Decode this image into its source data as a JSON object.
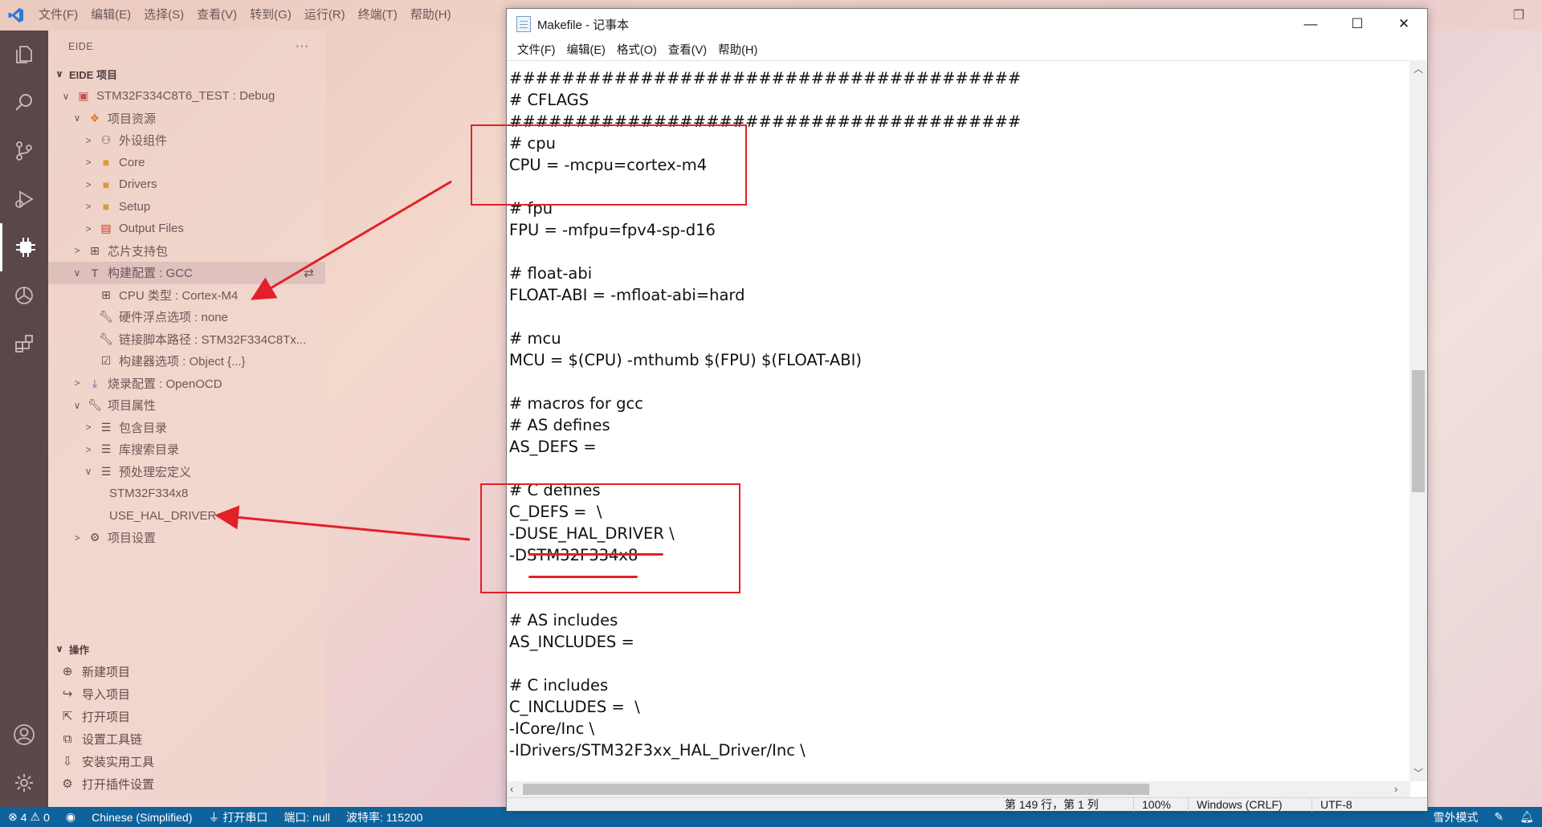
{
  "vscode": {
    "menu": [
      "文件(F)",
      "编辑(E)",
      "选择(S)",
      "查看(V)",
      "转到(G)",
      "运行(R)",
      "终端(T)",
      "帮助(H)"
    ],
    "sidebar": {
      "title": "EIDE",
      "more": "···",
      "section": "EIDE 项目",
      "tree": [
        {
          "label": "STM32F334C8T6_TEST : Debug",
          "indent": 1,
          "chev": "∨",
          "icon": "project-icon",
          "color": "#c0504d"
        },
        {
          "label": "项目资源",
          "indent": 2,
          "chev": "∨",
          "icon": "resources-icon",
          "color": "#e07b2a"
        },
        {
          "label": "外设组件",
          "indent": 3,
          "chev": ">",
          "icon": "components-icon",
          "color": "#6b5858"
        },
        {
          "label": "Core",
          "indent": 3,
          "chev": ">",
          "icon": "folder-icon",
          "color": "#d99a3a"
        },
        {
          "label": "Drivers",
          "indent": 3,
          "chev": ">",
          "icon": "folder-icon",
          "color": "#d99a3a"
        },
        {
          "label": "Setup",
          "indent": 3,
          "chev": ">",
          "icon": "folder-icon",
          "color": "#d99a3a"
        },
        {
          "label": "Output Files",
          "indent": 3,
          "chev": ">",
          "icon": "output-icon",
          "color": "#c0392b"
        },
        {
          "label": "芯片支持包",
          "indent": 2,
          "chev": ">",
          "icon": "chip-icon",
          "color": "#5e4a4a"
        },
        {
          "label": "构建配置 : GCC",
          "indent": 2,
          "chev": "∨",
          "icon": "build-icon",
          "color": "#5e4a4a",
          "selected": true
        },
        {
          "label": "CPU 类型 : Cortex-M4",
          "indent": 3,
          "chev": "",
          "icon": "chip-icon",
          "color": "#5e4a4a"
        },
        {
          "label": "硬件浮点选项 : none",
          "indent": 3,
          "chev": "",
          "icon": "wrench-icon",
          "color": "#5e4a4a"
        },
        {
          "label": "链接脚本路径 : STM32F334C8Tx...",
          "indent": 3,
          "chev": "",
          "icon": "wrench-icon",
          "color": "#5e4a4a"
        },
        {
          "label": "构建器选项 : Object {...}",
          "indent": 3,
          "chev": "",
          "icon": "options-icon",
          "color": "#5e4a4a"
        },
        {
          "label": "烧录配置 : OpenOCD",
          "indent": 2,
          "chev": ">",
          "icon": "download-icon",
          "color": "#3a6fb0"
        },
        {
          "label": "项目属性",
          "indent": 2,
          "chev": "∨",
          "icon": "wrench-icon",
          "color": "#5e4a4a"
        },
        {
          "label": "包含目录",
          "indent": 3,
          "chev": ">",
          "icon": "list-icon",
          "color": "#5e4a4a"
        },
        {
          "label": "库搜索目录",
          "indent": 3,
          "chev": ">",
          "icon": "list-icon",
          "color": "#5e4a4a"
        },
        {
          "label": "预处理宏定义",
          "indent": 3,
          "chev": "∨",
          "icon": "list-icon",
          "color": "#5e4a4a"
        },
        {
          "label": "STM32F334x8",
          "indent": 4,
          "chev": "",
          "icon": "",
          "color": ""
        },
        {
          "label": "USE_HAL_DRIVER",
          "indent": 4,
          "chev": "",
          "icon": "",
          "color": ""
        },
        {
          "label": "项目设置",
          "indent": 2,
          "chev": ">",
          "icon": "gear-icon",
          "color": "#5e4a4a"
        }
      ],
      "ops_title": "操作",
      "ops": [
        {
          "label": "新建项目",
          "icon": "new-project-icon"
        },
        {
          "label": "导入项目",
          "icon": "import-icon"
        },
        {
          "label": "打开项目",
          "icon": "open-project-icon"
        },
        {
          "label": "设置工具链",
          "icon": "toolchain-icon"
        },
        {
          "label": "安装实用工具",
          "icon": "install-icon"
        },
        {
          "label": "打开插件设置",
          "icon": "gear-icon"
        }
      ]
    },
    "statusbar": {
      "errors": "4",
      "warnings": "0",
      "language": "Chinese (Simplified)",
      "serial": "打开串口",
      "port": "端口: null",
      "baud": "波特率: 115200",
      "right_text": "雪外模式"
    }
  },
  "notepad": {
    "title": "Makefile - 记事本",
    "menu": [
      "文件(F)",
      "编辑(E)",
      "格式(O)",
      "查看(V)",
      "帮助(H)"
    ],
    "lines": [
      "#######################################",
      "# CFLAGS",
      "#######################################",
      "# cpu",
      "CPU = -mcpu=cortex-m4",
      "",
      "# fpu",
      "FPU = -mfpu=fpv4-sp-d16",
      "",
      "# float-abi",
      "FLOAT-ABI = -mfloat-abi=hard",
      "",
      "# mcu",
      "MCU = $(CPU) -mthumb $(FPU) $(FLOAT-ABI)",
      "",
      "# macros for gcc",
      "# AS defines",
      "AS_DEFS = ",
      "",
      "# C defines",
      "C_DEFS =  \\",
      "-DUSE_HAL_DRIVER \\",
      "-DSTM32F334x8",
      "",
      "",
      "# AS includes",
      "AS_INCLUDES = ",
      "",
      "# C includes",
      "C_INCLUDES =  \\",
      "-ICore/Inc \\",
      "-IDrivers/STM32F3xx_HAL_Driver/Inc \\"
    ],
    "status": {
      "position": "第 149 行，第 1 列",
      "zoom": "100%",
      "eol": "Windows (CRLF)",
      "encoding": "UTF-8"
    }
  },
  "colors": {
    "annotation_red": "#e3202a",
    "statusbar_blue": "#0e639c"
  }
}
